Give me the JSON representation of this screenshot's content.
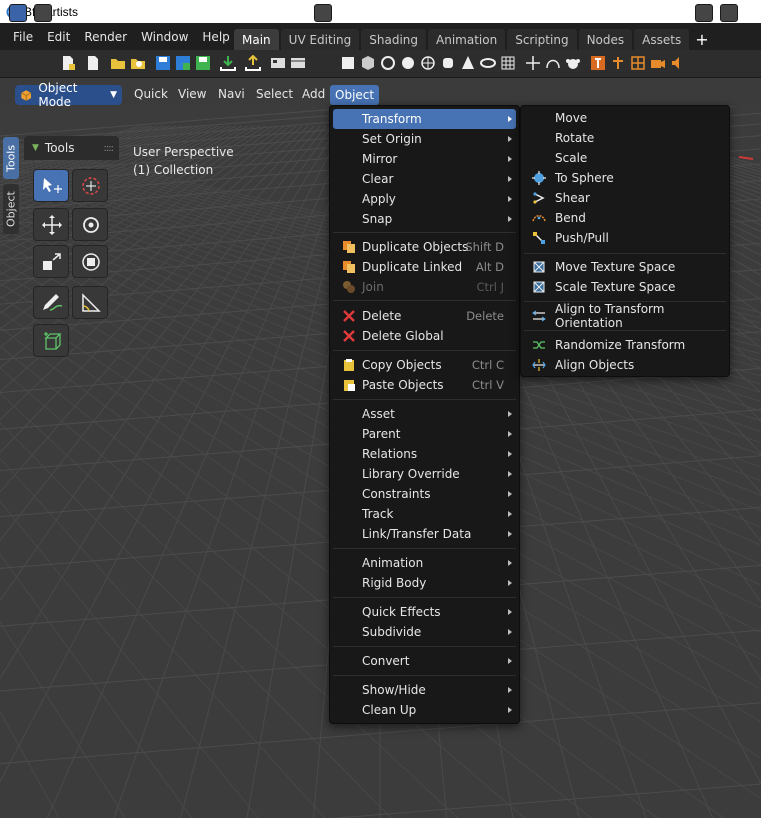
{
  "window": {
    "title": "Bforartists"
  },
  "menubar": {
    "items": [
      "File",
      "Edit",
      "Render",
      "Window",
      "Help"
    ]
  },
  "workspace_tabs": [
    "Main",
    "UV Editing",
    "Shading",
    "Animation",
    "Scripting",
    "Nodes",
    "Assets"
  ],
  "workspace_add": "+",
  "header": {
    "mode": "Object Mode",
    "menus": [
      "Quick",
      "View",
      "Navi",
      "Select",
      "Add",
      "Object"
    ]
  },
  "side_tabs": [
    "Tools",
    "Object"
  ],
  "tools_panel": {
    "title": "Tools"
  },
  "viewport": {
    "perspective": "User Perspective",
    "collection": "(1) Collection"
  },
  "object_menu": {
    "items": [
      {
        "label": "Transform",
        "submenu": true,
        "highlighted": true
      },
      {
        "label": "Set Origin",
        "submenu": true
      },
      {
        "label": "Mirror",
        "submenu": true
      },
      {
        "label": "Clear",
        "submenu": true
      },
      {
        "label": "Apply",
        "submenu": true
      },
      {
        "label": "Snap",
        "submenu": true
      },
      {
        "label": "Duplicate Objects",
        "shortcut": "Shift D",
        "icon": "duplicate-icon"
      },
      {
        "label": "Duplicate Linked",
        "shortcut": "Alt D",
        "icon": "duplicate-linked-icon"
      },
      {
        "label": "Join",
        "shortcut": "Ctrl J",
        "icon": "join-icon",
        "disabled": true
      },
      {
        "label": "Delete",
        "shortcut": "Delete",
        "icon": "delete-icon"
      },
      {
        "label": "Delete Global",
        "icon": "delete-global-icon"
      },
      {
        "label": "Copy Objects",
        "shortcut": "Ctrl C",
        "icon": "copy-icon"
      },
      {
        "label": "Paste Objects",
        "shortcut": "Ctrl V",
        "icon": "paste-icon"
      },
      {
        "label": "Asset",
        "submenu": true
      },
      {
        "label": "Parent",
        "submenu": true
      },
      {
        "label": "Relations",
        "submenu": true
      },
      {
        "label": "Library Override",
        "submenu": true
      },
      {
        "label": "Constraints",
        "submenu": true
      },
      {
        "label": "Track",
        "submenu": true
      },
      {
        "label": "Link/Transfer Data",
        "submenu": true
      },
      {
        "label": "Animation",
        "submenu": true
      },
      {
        "label": "Rigid Body",
        "submenu": true
      },
      {
        "label": "Quick Effects",
        "submenu": true
      },
      {
        "label": "Subdivide",
        "submenu": true
      },
      {
        "label": "Convert",
        "submenu": true
      },
      {
        "label": "Show/Hide",
        "submenu": true
      },
      {
        "label": "Clean Up",
        "submenu": true
      }
    ]
  },
  "transform_menu": {
    "items": [
      {
        "label": "Move"
      },
      {
        "label": "Rotate"
      },
      {
        "label": "Scale"
      },
      {
        "label": "To Sphere",
        "icon": "to-sphere-icon"
      },
      {
        "label": "Shear",
        "icon": "shear-icon"
      },
      {
        "label": "Bend",
        "icon": "bend-icon"
      },
      {
        "label": "Push/Pull",
        "icon": "push-pull-icon"
      },
      {
        "label": "Move Texture Space",
        "icon": "move-texture-space-icon"
      },
      {
        "label": "Scale Texture Space",
        "icon": "scale-texture-space-icon"
      },
      {
        "label": "Align to Transform Orientation",
        "icon": "align-orientation-icon"
      },
      {
        "label": "Randomize Transform",
        "icon": "randomize-icon"
      },
      {
        "label": "Align Objects",
        "icon": "align-objects-icon"
      }
    ]
  },
  "colors": {
    "accent": "#4772b3",
    "menu_bg": "#181818",
    "viewport_bg": "#3c3c3c",
    "danger": "#e03a3a"
  }
}
